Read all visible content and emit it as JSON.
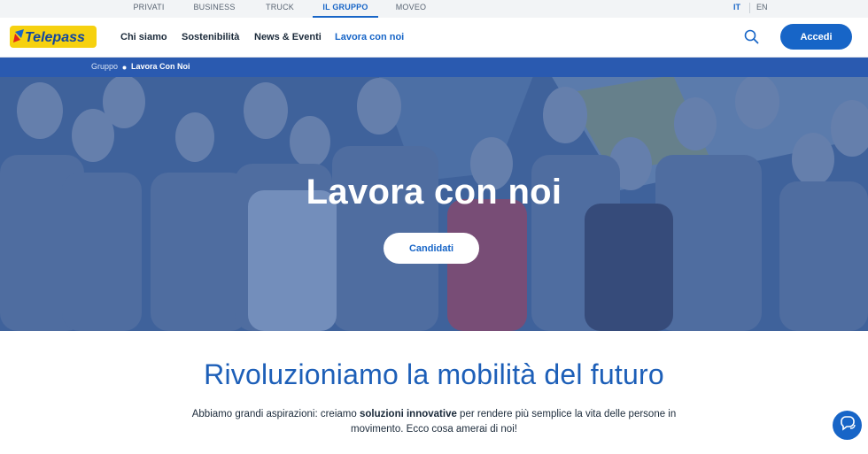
{
  "topbar": {
    "segments": [
      "PRIVATI",
      "BUSINESS",
      "TRUCK",
      "IL GRUPPO",
      "MOVEO"
    ],
    "active_segment": "IL GRUPPO",
    "languages": [
      "IT",
      "EN"
    ],
    "active_language": "IT"
  },
  "header": {
    "logo_text": "Telepass",
    "nav": [
      "Chi siamo",
      "Sostenibilità",
      "News & Eventi",
      "Lavora con noi"
    ],
    "active_nav": "Lavora con noi",
    "login_label": "Accedi"
  },
  "breadcrumb": {
    "items": [
      "Gruppo",
      "Lavora Con Noi"
    ]
  },
  "hero": {
    "title": "Lavora con noi",
    "cta_label": "Candidati"
  },
  "intro": {
    "title": "Rivoluzioniamo la mobilità del futuro",
    "text_before": "Abbiamo grandi aspirazioni: creiamo ",
    "text_bold": "soluzioni innovative",
    "text_after": " per rendere più semplice la vita delle persone in movimento. Ecco cosa amerai di noi!"
  },
  "colors": {
    "brand_blue": "#1765c7",
    "brand_yellow": "#f6d10f",
    "hero_overlay": "#2a5ab0"
  },
  "icons": [
    "search-icon",
    "chat-icon",
    "breadcrumb-dot-icon"
  ]
}
